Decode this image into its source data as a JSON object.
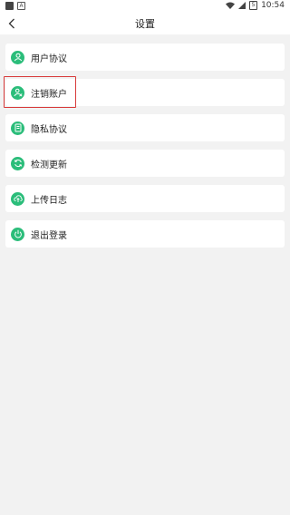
{
  "status_bar": {
    "time": "10:54",
    "battery_level": "5"
  },
  "header": {
    "title": "设置"
  },
  "menu": [
    {
      "label": "用户协议",
      "icon": "user-agreement-icon"
    },
    {
      "label": "注销账户",
      "icon": "cancel-account-icon"
    },
    {
      "label": "隐私协议",
      "icon": "privacy-icon"
    },
    {
      "label": "检测更新",
      "icon": "check-update-icon"
    },
    {
      "label": "上传日志",
      "icon": "upload-log-icon"
    },
    {
      "label": "退出登录",
      "icon": "logout-icon"
    }
  ],
  "colors": {
    "accent": "#2bbd7a",
    "highlight_border": "#d83a3a",
    "background": "#f2f2f2"
  }
}
